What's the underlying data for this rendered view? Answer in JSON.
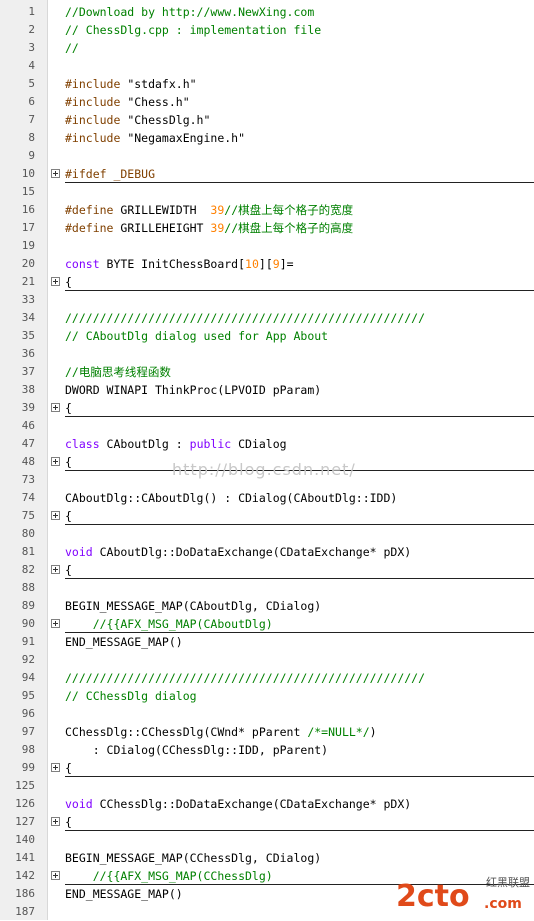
{
  "editor": {
    "watermark": "http://blog.csdn.net/",
    "logo": {
      "main": "2cto",
      "sub": ".com",
      "cn": "红黑联盟"
    },
    "lines": [
      {
        "num": "1",
        "fold": false,
        "sep": false,
        "tokens": [
          {
            "t": "//Download by http://www.NewXing.com",
            "c": "comment"
          }
        ]
      },
      {
        "num": "2",
        "fold": false,
        "sep": false,
        "tokens": [
          {
            "t": "// ChessDlg.cpp : implementation file",
            "c": "comment"
          }
        ]
      },
      {
        "num": "3",
        "fold": false,
        "sep": false,
        "tokens": [
          {
            "t": "//",
            "c": "comment"
          }
        ]
      },
      {
        "num": "4",
        "fold": false,
        "sep": false,
        "tokens": []
      },
      {
        "num": "5",
        "fold": false,
        "sep": false,
        "tokens": [
          {
            "t": "#include ",
            "c": "directive"
          },
          {
            "t": "\"stdafx.h\"",
            "c": "text"
          }
        ]
      },
      {
        "num": "6",
        "fold": false,
        "sep": false,
        "tokens": [
          {
            "t": "#include ",
            "c": "directive"
          },
          {
            "t": "\"Chess.h\"",
            "c": "text"
          }
        ]
      },
      {
        "num": "7",
        "fold": false,
        "sep": false,
        "tokens": [
          {
            "t": "#include ",
            "c": "directive"
          },
          {
            "t": "\"ChessDlg.h\"",
            "c": "text"
          }
        ]
      },
      {
        "num": "8",
        "fold": false,
        "sep": false,
        "tokens": [
          {
            "t": "#include ",
            "c": "directive"
          },
          {
            "t": "\"NegamaxEngine.h\"",
            "c": "text"
          }
        ]
      },
      {
        "num": "9",
        "fold": false,
        "sep": false,
        "tokens": []
      },
      {
        "num": "10",
        "fold": true,
        "sep": true,
        "tokens": [
          {
            "t": "#ifdef _DEBUG",
            "c": "directive"
          }
        ]
      },
      {
        "num": "15",
        "fold": false,
        "sep": false,
        "tokens": []
      },
      {
        "num": "16",
        "fold": false,
        "sep": false,
        "tokens": [
          {
            "t": "#define ",
            "c": "directive"
          },
          {
            "t": "GRILLEWIDTH  ",
            "c": "text"
          },
          {
            "t": "39",
            "c": "number"
          },
          {
            "t": "//棋盘上每个格子的宽度",
            "c": "comment"
          }
        ]
      },
      {
        "num": "17",
        "fold": false,
        "sep": false,
        "tokens": [
          {
            "t": "#define ",
            "c": "directive"
          },
          {
            "t": "GRILLEHEIGHT ",
            "c": "text"
          },
          {
            "t": "39",
            "c": "number"
          },
          {
            "t": "//棋盘上每个格子的高度",
            "c": "comment"
          }
        ]
      },
      {
        "num": "19",
        "fold": false,
        "sep": false,
        "tokens": []
      },
      {
        "num": "20",
        "fold": false,
        "sep": false,
        "tokens": [
          {
            "t": "const ",
            "c": "keyword"
          },
          {
            "t": "BYTE InitChessBoard[",
            "c": "text"
          },
          {
            "t": "10",
            "c": "number"
          },
          {
            "t": "][",
            "c": "text"
          },
          {
            "t": "9",
            "c": "number"
          },
          {
            "t": "]=",
            "c": "text"
          }
        ]
      },
      {
        "num": "21",
        "fold": true,
        "sep": true,
        "tokens": [
          {
            "t": "{",
            "c": "text"
          }
        ]
      },
      {
        "num": "33",
        "fold": false,
        "sep": false,
        "tokens": []
      },
      {
        "num": "34",
        "fold": false,
        "sep": false,
        "tokens": [
          {
            "t": "////////////////////////////////////////////////////",
            "c": "comment"
          }
        ]
      },
      {
        "num": "35",
        "fold": false,
        "sep": false,
        "tokens": [
          {
            "t": "// CAboutDlg dialog used for App About",
            "c": "comment"
          }
        ]
      },
      {
        "num": "36",
        "fold": false,
        "sep": false,
        "tokens": []
      },
      {
        "num": "37",
        "fold": false,
        "sep": false,
        "tokens": [
          {
            "t": "//电脑思考线程函数",
            "c": "comment"
          }
        ]
      },
      {
        "num": "38",
        "fold": false,
        "sep": false,
        "tokens": [
          {
            "t": "DWORD WINAPI ThinkProc(LPVOID pParam)",
            "c": "text"
          }
        ]
      },
      {
        "num": "39",
        "fold": true,
        "sep": true,
        "tokens": [
          {
            "t": "{",
            "c": "text"
          }
        ]
      },
      {
        "num": "46",
        "fold": false,
        "sep": false,
        "tokens": []
      },
      {
        "num": "47",
        "fold": false,
        "sep": false,
        "tokens": [
          {
            "t": "class ",
            "c": "keyword"
          },
          {
            "t": "CAboutDlg : ",
            "c": "text"
          },
          {
            "t": "public ",
            "c": "keyword"
          },
          {
            "t": "CDialog",
            "c": "text"
          }
        ]
      },
      {
        "num": "48",
        "fold": true,
        "sep": true,
        "tokens": [
          {
            "t": "{",
            "c": "text"
          }
        ]
      },
      {
        "num": "73",
        "fold": false,
        "sep": false,
        "tokens": []
      },
      {
        "num": "74",
        "fold": false,
        "sep": false,
        "tokens": [
          {
            "t": "CAboutDlg::CAboutDlg() : CDialog(CAboutDlg::IDD)",
            "c": "text"
          }
        ]
      },
      {
        "num": "75",
        "fold": true,
        "sep": true,
        "tokens": [
          {
            "t": "{",
            "c": "text"
          }
        ]
      },
      {
        "num": "80",
        "fold": false,
        "sep": false,
        "tokens": []
      },
      {
        "num": "81",
        "fold": false,
        "sep": false,
        "tokens": [
          {
            "t": "void ",
            "c": "keyword"
          },
          {
            "t": "CAboutDlg::DoDataExchange(CDataExchange* pDX)",
            "c": "text"
          }
        ]
      },
      {
        "num": "82",
        "fold": true,
        "sep": true,
        "tokens": [
          {
            "t": "{",
            "c": "text"
          }
        ]
      },
      {
        "num": "88",
        "fold": false,
        "sep": false,
        "tokens": []
      },
      {
        "num": "89",
        "fold": false,
        "sep": false,
        "tokens": [
          {
            "t": "BEGIN_MESSAGE_MAP(CAboutDlg, CDialog)",
            "c": "text"
          }
        ]
      },
      {
        "num": "90",
        "fold": true,
        "sep": true,
        "tokens": [
          {
            "t": "    //{{AFX_MSG_MAP(CAboutDlg)",
            "c": "comment"
          }
        ]
      },
      {
        "num": "91",
        "fold": false,
        "sep": false,
        "tokens": [
          {
            "t": "END_MESSAGE_MAP()",
            "c": "text"
          }
        ]
      },
      {
        "num": "92",
        "fold": false,
        "sep": false,
        "tokens": []
      },
      {
        "num": "94",
        "fold": false,
        "sep": false,
        "tokens": [
          {
            "t": "////////////////////////////////////////////////////",
            "c": "comment"
          }
        ]
      },
      {
        "num": "95",
        "fold": false,
        "sep": false,
        "tokens": [
          {
            "t": "// CChessDlg dialog",
            "c": "comment"
          }
        ]
      },
      {
        "num": "96",
        "fold": false,
        "sep": false,
        "tokens": []
      },
      {
        "num": "97",
        "fold": false,
        "sep": false,
        "tokens": [
          {
            "t": "CChessDlg::CChessDlg(CWnd* pParent ",
            "c": "text"
          },
          {
            "t": "/*=NULL*/",
            "c": "comment"
          },
          {
            "t": ")",
            "c": "text"
          }
        ]
      },
      {
        "num": "98",
        "fold": false,
        "sep": false,
        "tokens": [
          {
            "t": "    : CDialog(CChessDlg::IDD, pParent)",
            "c": "text"
          }
        ]
      },
      {
        "num": "99",
        "fold": true,
        "sep": true,
        "tokens": [
          {
            "t": "{",
            "c": "text"
          }
        ]
      },
      {
        "num": "125",
        "fold": false,
        "sep": false,
        "tokens": []
      },
      {
        "num": "126",
        "fold": false,
        "sep": false,
        "tokens": [
          {
            "t": "void ",
            "c": "keyword"
          },
          {
            "t": "CChessDlg::DoDataExchange(CDataExchange* pDX)",
            "c": "text"
          }
        ]
      },
      {
        "num": "127",
        "fold": true,
        "sep": true,
        "tokens": [
          {
            "t": "{",
            "c": "text"
          }
        ]
      },
      {
        "num": "140",
        "fold": false,
        "sep": false,
        "tokens": []
      },
      {
        "num": "141",
        "fold": false,
        "sep": false,
        "tokens": [
          {
            "t": "BEGIN_MESSAGE_MAP(CChessDlg, CDialog)",
            "c": "text"
          }
        ]
      },
      {
        "num": "142",
        "fold": true,
        "sep": true,
        "tokens": [
          {
            "t": "    //{{AFX_MSG_MAP(CChessDlg)",
            "c": "comment"
          }
        ]
      },
      {
        "num": "186",
        "fold": false,
        "sep": false,
        "tokens": [
          {
            "t": "END_MESSAGE_MAP()",
            "c": "text"
          }
        ]
      },
      {
        "num": "187",
        "fold": false,
        "sep": false,
        "tokens": []
      }
    ]
  }
}
